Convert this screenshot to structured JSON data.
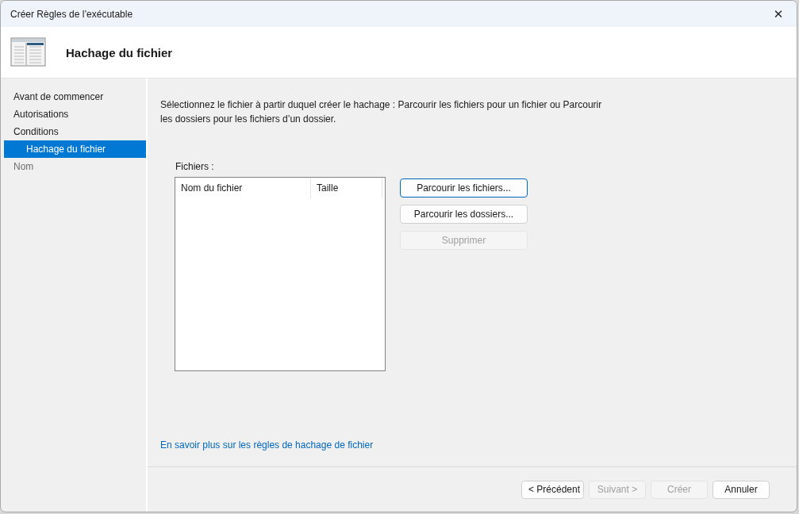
{
  "window": {
    "title": "Créer Règles de l’exécutable",
    "close_glyph": "✕"
  },
  "header": {
    "title": "Hachage du fichier"
  },
  "sidebar": {
    "items": [
      {
        "label": "Avant de commencer",
        "selected": false,
        "disabled": false
      },
      {
        "label": "Autorisations",
        "selected": false,
        "disabled": false
      },
      {
        "label": "Conditions",
        "selected": false,
        "disabled": false,
        "children": [
          {
            "label": "Hachage du fichier",
            "selected": true,
            "disabled": false
          }
        ]
      },
      {
        "label": "Nom",
        "selected": false,
        "disabled": true
      }
    ]
  },
  "content": {
    "description": "Sélectionnez le fichier à partir duquel créer le hachage : Parcourir les fichiers pour un fichier ou Parcourir les dossiers pour les fichiers d’un dossier.",
    "files_label": "Fichiers :",
    "table": {
      "columns": [
        "Nom du fichier",
        "Taille"
      ]
    },
    "buttons": [
      {
        "label": "Parcourir les fichiers...",
        "disabled": false,
        "default": true
      },
      {
        "label": "Parcourir les dossiers...",
        "disabled": false,
        "default": false
      },
      {
        "label": "Supprimer",
        "disabled": true,
        "default": false
      }
    ],
    "link": "En savoir plus sur les règles de hachage de fichier"
  },
  "footer": {
    "buttons": [
      {
        "label": "< Précédent",
        "disabled": false
      },
      {
        "label": "Suivant >",
        "disabled": true
      },
      {
        "label": "Créer",
        "disabled": true
      },
      {
        "label": "Annuler",
        "disabled": false
      }
    ]
  }
}
